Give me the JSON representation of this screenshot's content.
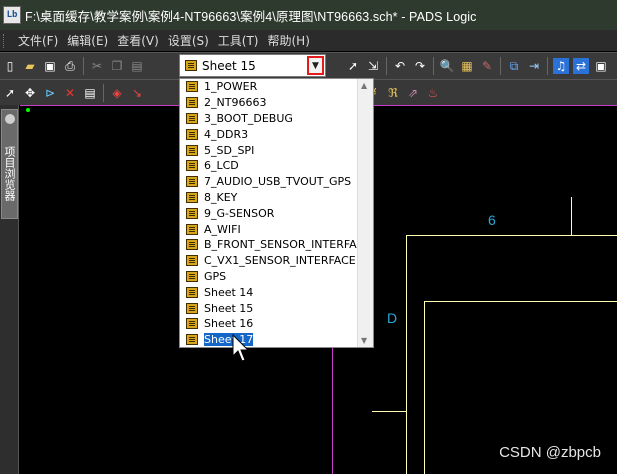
{
  "window": {
    "title": "F:\\桌面缓存\\教学案例\\案例4-NT96663\\案例4\\原理图\\NT96663.sch* - PADS Logic",
    "app_icon_text": "Lb"
  },
  "menu": {
    "items": [
      "文件(F)",
      "编辑(E)",
      "查看(V)",
      "设置(S)",
      "工具(T)",
      "帮助(H)"
    ]
  },
  "sheet_select": {
    "value": "Sheet 15",
    "options": [
      "1_POWER",
      "2_NT96663",
      "3_BOOT_DEBUG",
      "4_DDR3",
      "5_SD_SPI",
      "6_LCD",
      "7_AUDIO_USB_TVOUT_GPS",
      "8_KEY",
      "9_G-SENSOR",
      "A_WIFI",
      "B_FRONT_SENSOR_INTERFACE",
      "C_VX1_SENSOR_INTERFACE",
      "GPS",
      "Sheet 14",
      "Sheet 15",
      "Sheet 16",
      "Sheet 17"
    ],
    "highlighted": "Sheet 17"
  },
  "dock": {
    "tab_label": "项目浏览器"
  },
  "canvas": {
    "zone_col_label": "6",
    "zone_row_label": "D"
  },
  "watermark": "CSDN @zbpcb",
  "colors": {
    "titlebar": "#2f3a2e",
    "selection": "#1466c8",
    "zone_label": "#2aa8d8",
    "border_line": "#c83cc8",
    "frame_line": "#ffffb0"
  }
}
